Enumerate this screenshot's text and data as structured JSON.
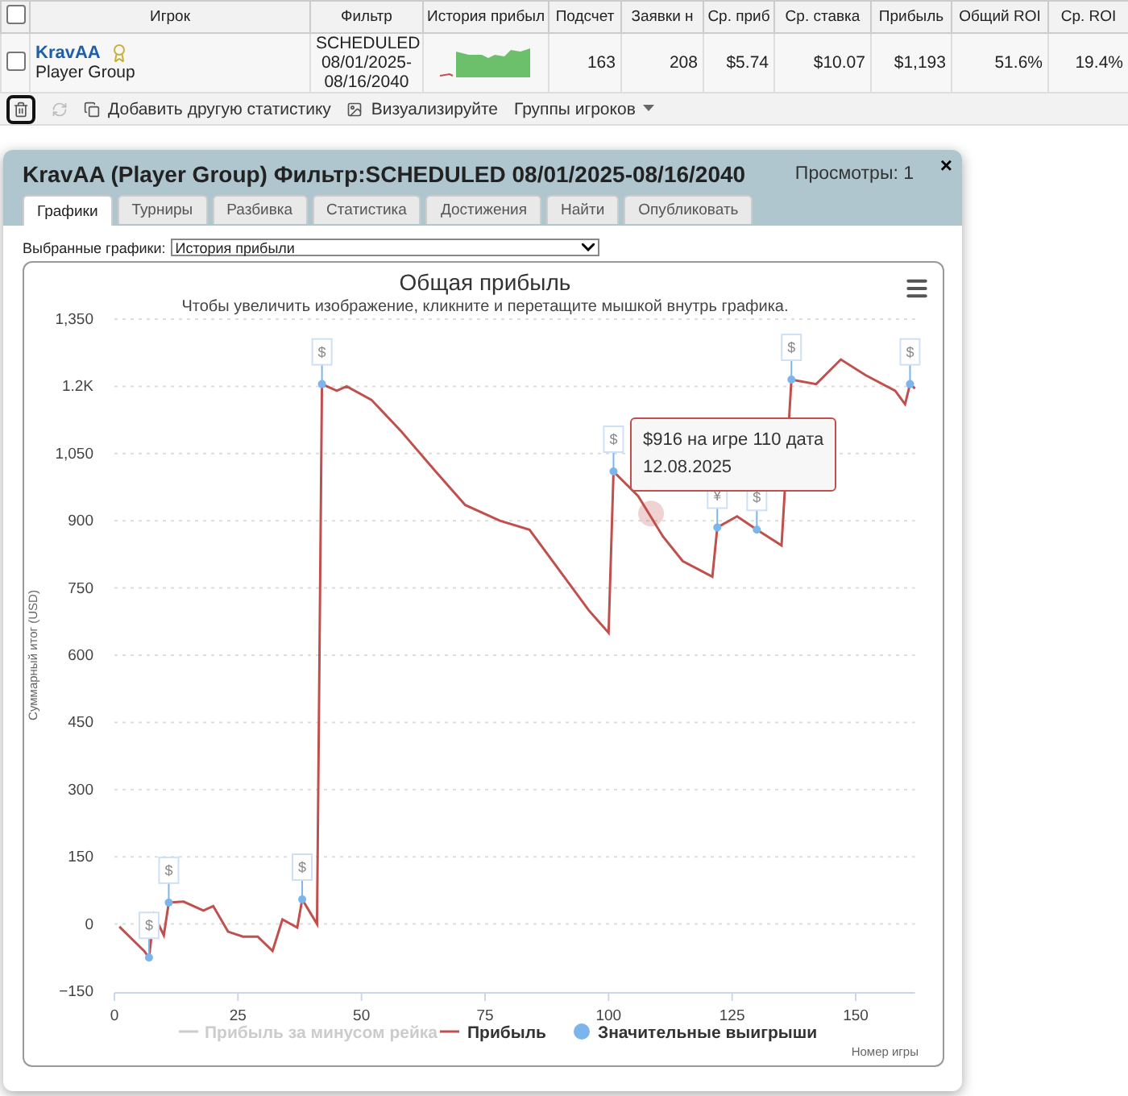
{
  "table": {
    "columns": [
      "",
      "Игрок",
      "Фильтр",
      "История прибыл",
      "Подсчет",
      "Заявки н",
      "Ср. приб",
      "Ср. ставка",
      "Прибыль",
      "Общий ROI",
      "Ср. ROI"
    ],
    "header_checked": false,
    "rows": [
      {
        "cells": [
          {
            "kind": "check",
            "checked": false
          },
          {
            "kind": "player",
            "name": "KravAA",
            "group": "Player Group"
          },
          {
            "kind": "filter",
            "text": "SCHEDULED 08/01/2025-08/16/2040"
          },
          {
            "kind": "sparkline"
          },
          {
            "kind": "number",
            "text": "163"
          },
          {
            "kind": "number",
            "text": "208"
          },
          {
            "kind": "number",
            "text": "$5.74"
          },
          {
            "kind": "number",
            "text": "$10.07"
          },
          {
            "kind": "number",
            "text": "$1,193"
          },
          {
            "kind": "number",
            "text": "51.6%"
          },
          {
            "kind": "number",
            "text": "19.4%"
          }
        ]
      }
    ]
  },
  "toolbar": {
    "items": [
      {
        "kind": "delete",
        "disabled": false
      },
      {
        "kind": "refresh",
        "disabled": true
      },
      {
        "kind": "add",
        "label": "Добавить другую статистику",
        "disabled": false
      },
      {
        "kind": "visualize",
        "label": "Визуализируйте",
        "disabled": false
      },
      {
        "kind": "menu",
        "label": "Группы игроков",
        "disabled": false
      }
    ]
  },
  "dialog": {
    "title": "KravAA (Player Group) Фильтр:SCHEDULED 08/01/2025-08/16/2040",
    "views": "Просмотры: 1",
    "close": "×",
    "tabs": [
      {
        "label": "Графики",
        "selected": true
      },
      {
        "label": "Турниры",
        "selected": false
      },
      {
        "label": "Разбивка",
        "selected": false
      },
      {
        "label": "Статистика",
        "selected": false
      },
      {
        "label": "Достижения",
        "selected": false
      },
      {
        "label": "Найти",
        "selected": false
      },
      {
        "label": "Опубликовать",
        "selected": false
      }
    ],
    "select": {
      "label": "Выбранные графики:",
      "value": "История прибыли"
    },
    "chart": {
      "chart_data": {
        "type": "line",
        "title": "Общая прибыль",
        "xlabel": "Номер игры",
        "ylabel": "Суммарный итог (USD)",
        "grid": true,
        "legend": "bottom",
        "x": [
          1,
          6,
          7,
          8,
          10,
          11,
          14,
          18,
          20,
          23,
          26,
          29,
          32,
          34,
          37,
          38,
          41,
          42,
          45,
          47,
          52,
          58,
          65,
          71,
          78,
          84,
          91,
          96,
          100,
          101,
          106,
          111,
          115,
          121,
          122,
          126,
          130,
          135,
          137,
          142,
          147,
          152,
          158,
          160,
          161,
          162
        ],
        "series": [
          {
            "name": "Прибыль",
            "color": "#c0504d",
            "values": [
              -6,
              -60,
              -75,
              20,
              -25,
              48,
              50,
              30,
              40,
              -17,
              -28,
              -28,
              -60,
              10,
              -8,
              55,
              0,
              1205,
              1190,
              1200,
              1170,
              1100,
              1010,
              935,
              900,
              880,
              775,
              700,
              650,
              1010,
              955,
              865,
              810,
              775,
              885,
              910,
              880,
              845,
              1215,
              1205,
              1260,
              1225,
              1190,
              1160,
              1205,
              1195
            ]
          },
          {
            "name": "Значительные выигрыши",
            "color": "#7cb5ec",
            "marker": true,
            "values": [
              null,
              null,
              -75,
              null,
              null,
              48,
              null,
              null,
              null,
              null,
              null,
              null,
              null,
              null,
              null,
              55,
              null,
              1205,
              null,
              null,
              null,
              null,
              null,
              null,
              null,
              null,
              null,
              null,
              null,
              1010,
              null,
              null,
              null,
              null,
              885,
              null,
              880,
              null,
              1215,
              null,
              null,
              null,
              null,
              null,
              1205,
              null
            ]
          }
        ],
        "xlim": [
          0,
          162
        ],
        "ylim": [
          -150,
          1350
        ],
        "xticks": [
          0,
          25,
          50,
          75,
          100,
          125,
          150
        ],
        "yticks": [
          {
            "value": -150,
            "label": "−150"
          },
          0,
          150,
          300,
          450,
          600,
          750,
          900,
          {
            "value": 1050,
            "label": "1,050"
          },
          {
            "value": 1200,
            "label": "1.2K"
          },
          {
            "value": 1350,
            "label": "1,350"
          }
        ]
      },
      "subtitle": "Чтобы увеличить изображение, кликните и перетащите мышкой внутрь графика.",
      "flag_symbols": [
        "$",
        "$",
        "$",
        "$",
        "$",
        "¥",
        "$",
        "$",
        "$"
      ],
      "tooltip": [
        "$916 на игре 110 дата",
        "12.08.2025"
      ],
      "hidden_legend": [
        {
          "label": "Прибыль за минусом рейка",
          "visible": false
        }
      ]
    }
  }
}
